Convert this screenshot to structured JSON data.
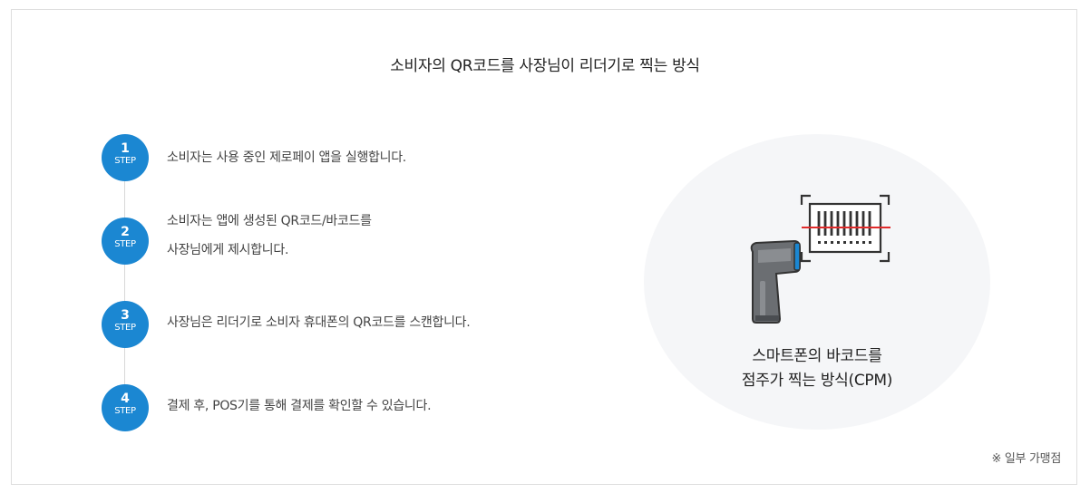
{
  "title": "소비자의 QR코드를 사장님이 리더기로 찍는 방식",
  "steps": [
    {
      "number": "1",
      "label": "STEP",
      "text_lines": [
        "소비자는 사용 중인 제로페이 앱을 실행합니다."
      ]
    },
    {
      "number": "2",
      "label": "STEP",
      "text_lines": [
        "소비자는 앱에 생성된 QR코드/바코드를",
        "사장님에게 제시합니다."
      ]
    },
    {
      "number": "3",
      "label": "STEP",
      "text_lines": [
        "사장님은 리더기로 소비자 휴대폰의 QR코드를 스캔합니다."
      ]
    },
    {
      "number": "4",
      "label": "STEP",
      "text_lines": [
        "결제 후, POS기를 통해 결제를 확인할 수 있습니다."
      ]
    }
  ],
  "illustration": {
    "icon": "barcode-scanner-icon",
    "caption_lines": [
      "스마트폰의 바코드를",
      "점주가 찍는 방식(CPM)"
    ]
  },
  "note": "※ 일부 가맹점",
  "colors": {
    "step_circle": "#1b87d2",
    "oval_background": "#f5f6f8",
    "scan_line": "#e02b2b",
    "scanner_accent": "#1b87d2"
  }
}
